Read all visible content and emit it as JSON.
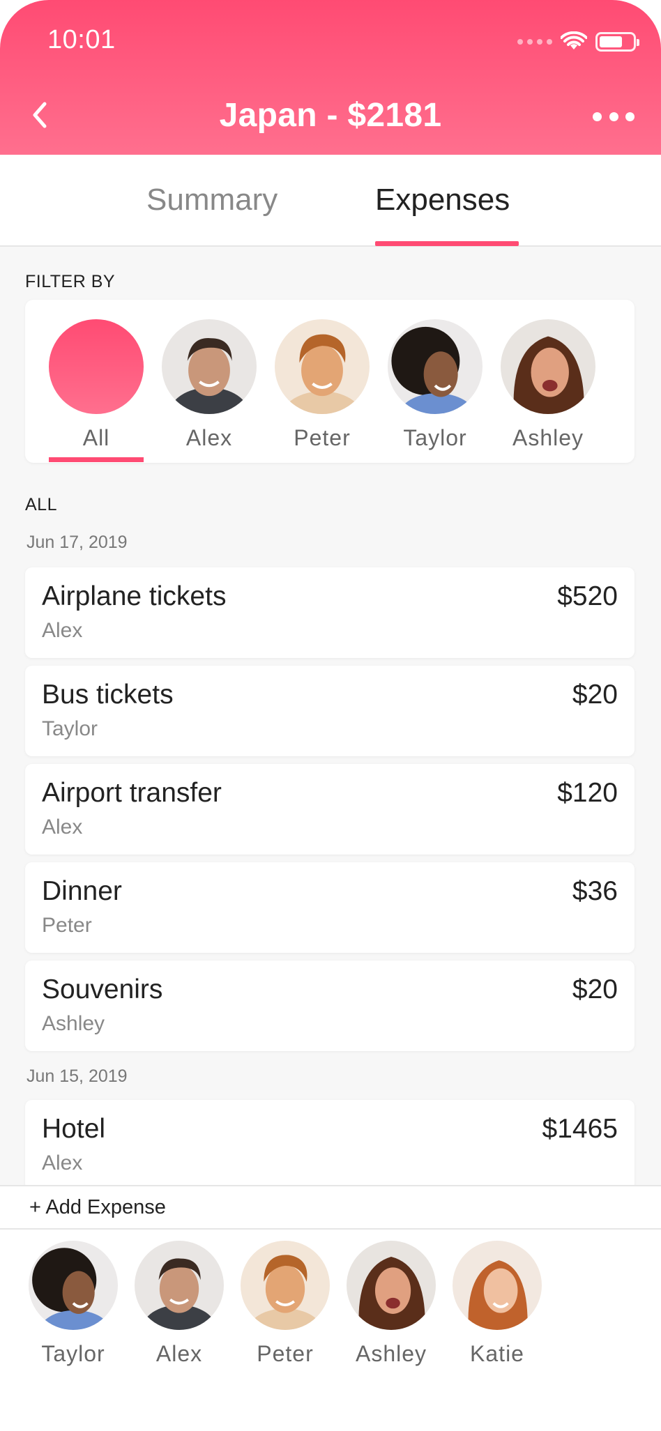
{
  "status_bar": {
    "time": "10:01"
  },
  "header": {
    "title": "Japan - $2181"
  },
  "tabs": [
    {
      "label": "Summary",
      "active": false
    },
    {
      "label": "Expenses",
      "active": true
    }
  ],
  "filter": {
    "label": "FILTER BY",
    "people": [
      "All",
      "Alex",
      "Peter",
      "Taylor",
      "Ashley"
    ],
    "selected": "All"
  },
  "list_label": "ALL",
  "groups": [
    {
      "date": "Jun 17, 2019",
      "expenses": [
        {
          "title": "Airplane tickets",
          "person": "Alex",
          "amount": "$520"
        },
        {
          "title": "Bus tickets",
          "person": "Taylor",
          "amount": "$20"
        },
        {
          "title": "Airport transfer",
          "person": "Alex",
          "amount": "$120"
        },
        {
          "title": "Dinner",
          "person": "Peter",
          "amount": "$36"
        },
        {
          "title": "Souvenirs",
          "person": "Ashley",
          "amount": "$20"
        }
      ]
    },
    {
      "date": "Jun 15, 2019",
      "expenses": [
        {
          "title": "Hotel",
          "person": "Alex",
          "amount": "$1465"
        }
      ]
    }
  ],
  "add_expense_label": "+ Add Expense",
  "bottom_people": [
    "Taylor",
    "Alex",
    "Peter",
    "Ashley",
    "Katie"
  ],
  "colors": {
    "accent": "#ff4b73",
    "accent_light": "#ff6f8e"
  }
}
